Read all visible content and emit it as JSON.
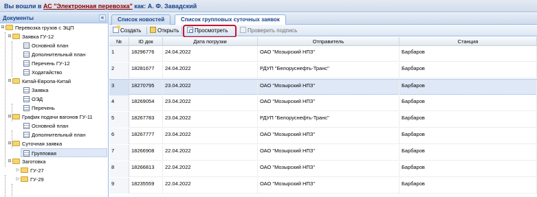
{
  "header": {
    "prefix": "Вы вошли в ",
    "app_link": "АС \"Электронная перевозка\"",
    "as_text": " как: ",
    "user": "А. Ф. Завадский"
  },
  "left_panel": {
    "title": "Документы",
    "collapse_glyph": "«",
    "tree": [
      {
        "label": "Перевозка грузов с ЭЦП"
      },
      {
        "label": "Заявка ГУ-12"
      },
      {
        "label": "Основной план"
      },
      {
        "label": "Дополнительный план"
      },
      {
        "label": "Перечень ГУ-12"
      },
      {
        "label": "Ходатайство"
      },
      {
        "label": "Китай-Европа-Китай"
      },
      {
        "label": "Заявка"
      },
      {
        "label": "ОЭД"
      },
      {
        "label": "Перечень"
      },
      {
        "label": "График подачи вагонов ГУ-11"
      },
      {
        "label": "Основной план"
      },
      {
        "label": "Дополнительный план"
      },
      {
        "label": "Суточная заявка"
      },
      {
        "label": "Групповая"
      },
      {
        "label": "Заготовка"
      },
      {
        "label": "ГУ-27"
      },
      {
        "label": "ГУ-29"
      }
    ]
  },
  "tabs": [
    {
      "label": "Список новостей"
    },
    {
      "label": "Список групповых суточных заявок"
    }
  ],
  "toolbar": {
    "create": "Создать",
    "open": "Открыть",
    "view": "Просмотреть",
    "verify": "Проверить подпись"
  },
  "grid": {
    "columns": [
      "№",
      "ID док",
      "Дата погрузки",
      "Отправитель",
      "Станция"
    ],
    "rows": [
      {
        "n": "1",
        "id": "18296776",
        "date": "24.04.2022",
        "sender": "ОАО \"Мозырский НПЗ\"",
        "station": "Барбаров"
      },
      {
        "n": "2",
        "id": "18281677",
        "date": "24.04.2022",
        "sender": "РДУП \"Белоруснефть-Транс\"",
        "station": "Барбаров"
      },
      {
        "n": "3",
        "id": "18270795",
        "date": "23.04.2022",
        "sender": "ОАО \"Мозырский НПЗ\"",
        "station": "Барбаров"
      },
      {
        "n": "4",
        "id": "18269054",
        "date": "23.04.2022",
        "sender": "ОАО \"Мозырский НПЗ\"",
        "station": "Барбаров"
      },
      {
        "n": "5",
        "id": "18267783",
        "date": "23.04.2022",
        "sender": "РДУП \"Белоруснефть-Транс\"",
        "station": "Барбаров"
      },
      {
        "n": "6",
        "id": "18267777",
        "date": "23.04.2022",
        "sender": "ОАО \"Мозырский НПЗ\"",
        "station": "Барбаров"
      },
      {
        "n": "7",
        "id": "18266908",
        "date": "22.04.2022",
        "sender": "ОАО \"Мозырский НПЗ\"",
        "station": "Барбаров"
      },
      {
        "n": "8",
        "id": "18266813",
        "date": "22.04.2022",
        "sender": "ОАО \"Мозырский НПЗ\"",
        "station": "Барбаров"
      },
      {
        "n": "9",
        "id": "18235559",
        "date": "22.04.2022",
        "sender": "ОАО \"Мозырский НПЗ\"",
        "station": "Барбаров"
      }
    ]
  },
  "colors": {
    "accent": "#15428b",
    "border": "#99bbe8",
    "highlight_box": "#c8102e",
    "selected_row": "#dfe8f6"
  }
}
